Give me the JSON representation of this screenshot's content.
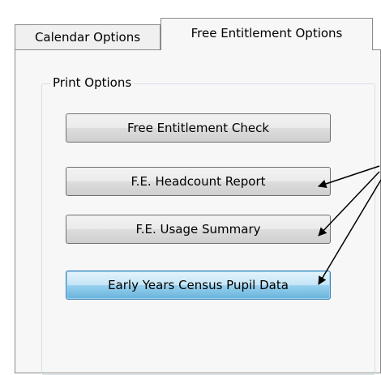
{
  "tabs": [
    {
      "label": "Calendar Options",
      "selected": false
    },
    {
      "label": "Free Entitlement Options",
      "selected": true
    }
  ],
  "print_options": {
    "group_label": "Print Options",
    "buttons": [
      {
        "label": "Free Entitlement Check"
      },
      {
        "label": "F.E. Headcount Report"
      },
      {
        "label": "F.E. Usage Summary"
      },
      {
        "label": "Early Years Census Pupil Data",
        "state": "hovered"
      }
    ]
  },
  "annotation": {
    "arrow_color": "#000000"
  }
}
